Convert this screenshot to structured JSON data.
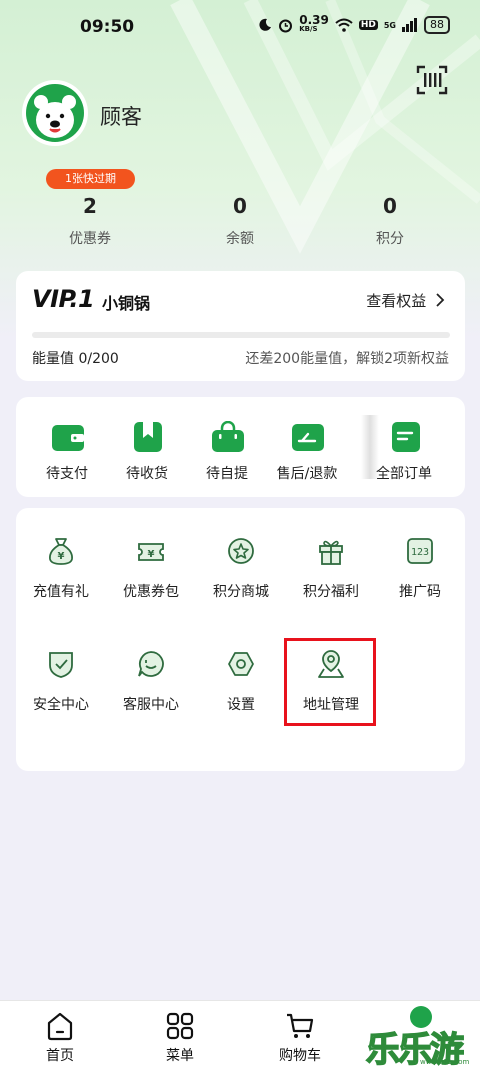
{
  "status_bar": {
    "time": "09:50",
    "net_speed_value": "0.39",
    "net_speed_unit": "KB/S",
    "hd_label": "HD",
    "signal_label": "5G",
    "battery": "88"
  },
  "profile": {
    "username": "顾客"
  },
  "stats": {
    "coupon_badge": "1张快过期",
    "items": [
      {
        "value": "2",
        "label": "优惠券"
      },
      {
        "value": "0",
        "label": "余额"
      },
      {
        "value": "0",
        "label": "积分"
      }
    ]
  },
  "vip": {
    "level": "VIP.1",
    "level_name": "小铜锅",
    "view_benefits": "查看权益",
    "energy": "能量值 0/200",
    "hint": "还差200能量值，解锁2项新权益",
    "progress": 0
  },
  "orders": {
    "items": [
      {
        "label": "待支付",
        "icon": "wallet-icon"
      },
      {
        "label": "待收货",
        "icon": "bookmark-icon"
      },
      {
        "label": "待自提",
        "icon": "shopping-bag-icon"
      },
      {
        "label": "售后/退款",
        "icon": "refund-icon"
      },
      {
        "label": "全部订单",
        "icon": "order-list-icon"
      }
    ]
  },
  "services": {
    "items": [
      {
        "label": "充值有礼",
        "icon": "money-bag-icon"
      },
      {
        "label": "优惠券包",
        "icon": "coupon-icon"
      },
      {
        "label": "积分商城",
        "icon": "star-badge-icon"
      },
      {
        "label": "积分福利",
        "icon": "gift-icon"
      },
      {
        "label": "推广码",
        "icon": "code-123-icon"
      },
      {
        "label": "安全中心",
        "icon": "shield-check-icon"
      },
      {
        "label": "客服中心",
        "icon": "chat-bubble-icon"
      },
      {
        "label": "设置",
        "icon": "settings-hex-icon"
      },
      {
        "label": "地址管理",
        "icon": "location-pin-icon"
      }
    ]
  },
  "bottom_nav": {
    "items": [
      {
        "label": "首页",
        "icon": "home-icon"
      },
      {
        "label": "菜单",
        "icon": "grid-icon"
      },
      {
        "label": "购物车",
        "icon": "cart-icon"
      }
    ]
  },
  "watermark": {
    "text": "乐乐游戏",
    "url": "www.611.com"
  },
  "colors": {
    "brand_green": "#1fa34a",
    "badge_orange": "#f2541e",
    "highlight_red": "#e8121c"
  }
}
